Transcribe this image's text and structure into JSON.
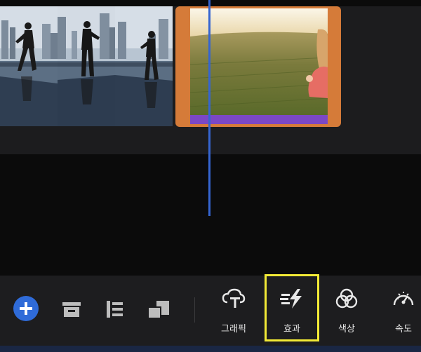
{
  "timeline": {
    "clips": [
      {
        "name": "dance-clip"
      },
      {
        "name": "field-clip"
      }
    ]
  },
  "toolbar": {
    "tools": [
      {
        "label": "그래픽",
        "icon": "graphic-icon"
      },
      {
        "label": "효과",
        "icon": "effect-icon"
      },
      {
        "label": "색상",
        "icon": "color-icon"
      },
      {
        "label": "속도",
        "icon": "speed-icon"
      }
    ],
    "left_buttons": [
      "add-icon",
      "archive-icon",
      "align-left-icon",
      "layer-icon"
    ]
  },
  "colors": {
    "accent_blue": "#2f6bd8",
    "clip_orange": "#d57b39",
    "audio_purple": "#7b48c5",
    "highlight_yellow": "#f2ea36"
  }
}
